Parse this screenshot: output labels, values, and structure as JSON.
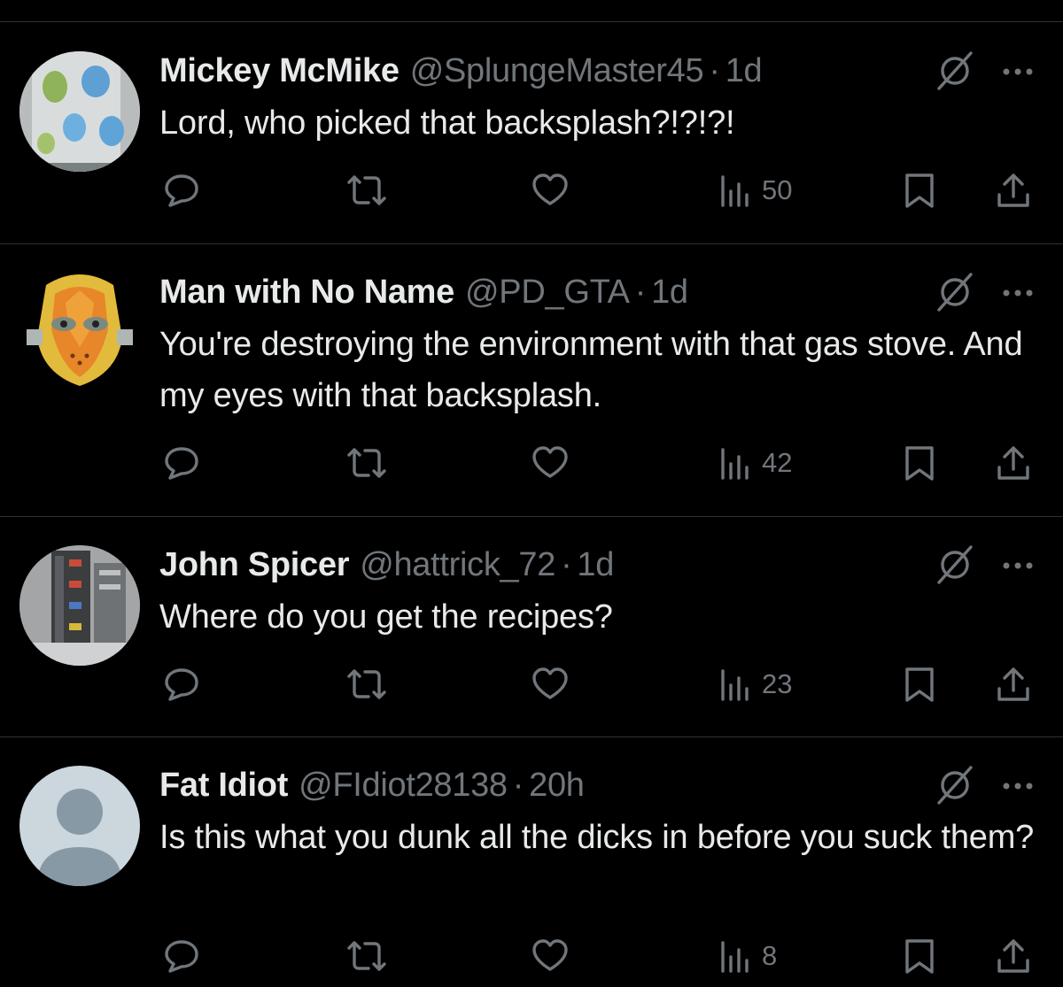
{
  "replies": [
    {
      "name": "Mickey McMike",
      "handle": "@SplungeMaster45",
      "separator": "·",
      "time": "1d",
      "text": "Lord, who picked that backsplash?!?!?!",
      "views": "50",
      "avatar_icon": "polka-dot-mug-photo"
    },
    {
      "name": "Man with No Name",
      "handle": "@PD_GTA",
      "separator": "·",
      "time": "1d",
      "text": "You're destroying the environment with that gas stove.  And my eyes with that backsplash.",
      "views": "42",
      "avatar_icon": "orange-flame-mask-photo"
    },
    {
      "name": "John Spicer",
      "handle": "@hattrick_72",
      "separator": "·",
      "time": "1d",
      "text": "Where do you get the recipes?",
      "views": "23",
      "avatar_icon": "server-rack-photo"
    },
    {
      "name": "Fat Idiot",
      "handle": "@FIdiot28138",
      "separator": "·",
      "time": "20h",
      "text": "Is this what you dunk all the dicks in before you suck them?",
      "views": "8",
      "avatar_icon": "default-user-icon"
    }
  ],
  "icons": {
    "reply": "speech-bubble-icon",
    "repost": "repost-arrows-icon",
    "like": "heart-icon",
    "views": "bar-chart-icon",
    "bookmark": "bookmark-icon",
    "share": "share-upload-icon",
    "grok": "grok-slash-icon",
    "more": "more-dots-icon"
  },
  "colors": {
    "background": "#000000",
    "primary_text": "#e7e9ea",
    "secondary_text": "#71767b",
    "divider": "#2f3336"
  }
}
